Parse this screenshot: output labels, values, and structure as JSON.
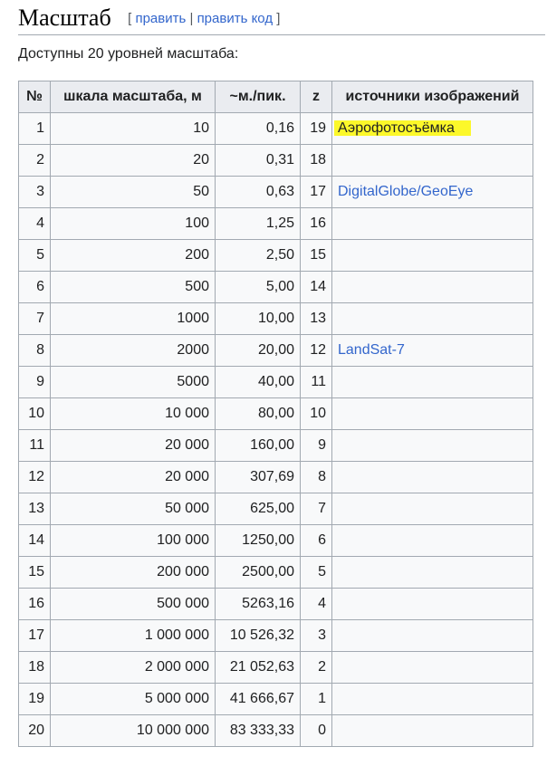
{
  "section": {
    "title": "Масштаб",
    "edit_open": "[",
    "edit_link": "править",
    "edit_sep": "|",
    "edit_code_link": "править код",
    "edit_close": "]"
  },
  "intro": "Доступны 20 уровней масштаба:",
  "table": {
    "headers": [
      "№",
      "шкала масштаба, м",
      "~м./пик.",
      "z",
      "источники изображений"
    ],
    "rows": [
      [
        "1",
        "10",
        "0,16",
        "19",
        "Аэрофотосъёмка"
      ],
      [
        "2",
        "20",
        "0,31",
        "18",
        ""
      ],
      [
        "3",
        "50",
        "0,63",
        "17",
        "DigitalGlobe/GeoEye"
      ],
      [
        "4",
        "100",
        "1,25",
        "16",
        ""
      ],
      [
        "5",
        "200",
        "2,50",
        "15",
        ""
      ],
      [
        "6",
        "500",
        "5,00",
        "14",
        ""
      ],
      [
        "7",
        "1000",
        "10,00",
        "13",
        ""
      ],
      [
        "8",
        "2000",
        "20,00",
        "12",
        "LandSat-7"
      ],
      [
        "9",
        "5000",
        "40,00",
        "11",
        ""
      ],
      [
        "10",
        "10 000",
        "80,00",
        "10",
        ""
      ],
      [
        "11",
        "20 000",
        "160,00",
        "9",
        ""
      ],
      [
        "12",
        "20 000",
        "307,69",
        "8",
        ""
      ],
      [
        "13",
        "50 000",
        "625,00",
        "7",
        ""
      ],
      [
        "14",
        "100 000",
        "1250,00",
        "6",
        ""
      ],
      [
        "15",
        "200 000",
        "2500,00",
        "5",
        ""
      ],
      [
        "16",
        "500 000",
        "5263,16",
        "4",
        ""
      ],
      [
        "17",
        "1 000 000",
        "10 526,32",
        "3",
        ""
      ],
      [
        "18",
        "2 000 000",
        "21 052,63",
        "2",
        ""
      ],
      [
        "19",
        "5 000 000",
        "41 666,67",
        "1",
        ""
      ],
      [
        "20",
        "10 000 000",
        "83 333,33",
        "0",
        ""
      ]
    ]
  },
  "colors": {
    "link": "#3366cc",
    "highlight": "#fcf82a",
    "header_bg": "#eaecf0",
    "border": "#a2a9b1"
  }
}
